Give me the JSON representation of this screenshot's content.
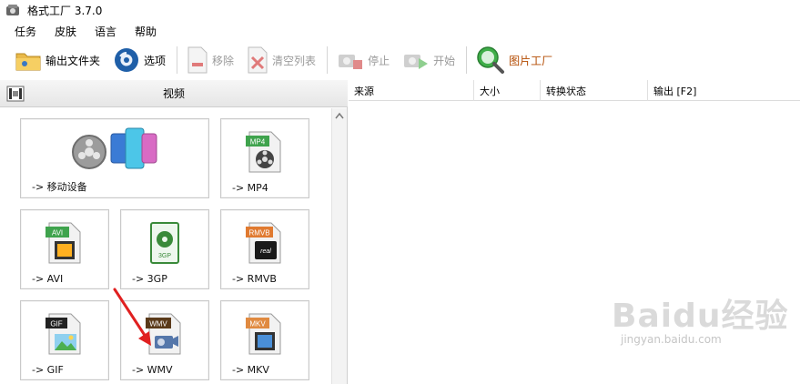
{
  "window": {
    "title": "格式工厂 3.7.0"
  },
  "menu": {
    "items": [
      "任务",
      "皮肤",
      "语言",
      "帮助"
    ]
  },
  "toolbar": {
    "output_folder": "输出文件夹",
    "options": "选项",
    "remove": "移除",
    "clear_list": "清空列表",
    "stop": "停止",
    "start": "开始",
    "picture_factory": "图片工厂"
  },
  "category": {
    "title": "视频"
  },
  "tiles": [
    {
      "label": "-> 移动设备",
      "icon": "mobile-device-icon"
    },
    {
      "label": "-> MP4",
      "icon": "mp4-file-icon",
      "badge": "MP4"
    },
    {
      "label": "-> AVI",
      "icon": "avi-file-icon",
      "badge": "AVI"
    },
    {
      "label": "-> 3GP",
      "icon": "3gp-file-icon",
      "badge": "3GP"
    },
    {
      "label": "-> RMVB",
      "icon": "rmvb-file-icon",
      "badge": "RMVB"
    },
    {
      "label": "-> GIF",
      "icon": "gif-file-icon",
      "badge": "GIF"
    },
    {
      "label": "-> WMV",
      "icon": "wmv-file-icon",
      "badge": "WMV"
    },
    {
      "label": "-> MKV",
      "icon": "mkv-file-icon",
      "badge": "MKV"
    }
  ],
  "list": {
    "columns": [
      "来源",
      "大小",
      "转换状态",
      "输出 [F2]"
    ]
  },
  "watermark": {
    "main": "Baidu经验",
    "sub": "jingyan.baidu.com"
  },
  "colors": {
    "accent_orange": "#b34a00",
    "arrow_red": "#e02020",
    "header_bg": "#ececec"
  }
}
